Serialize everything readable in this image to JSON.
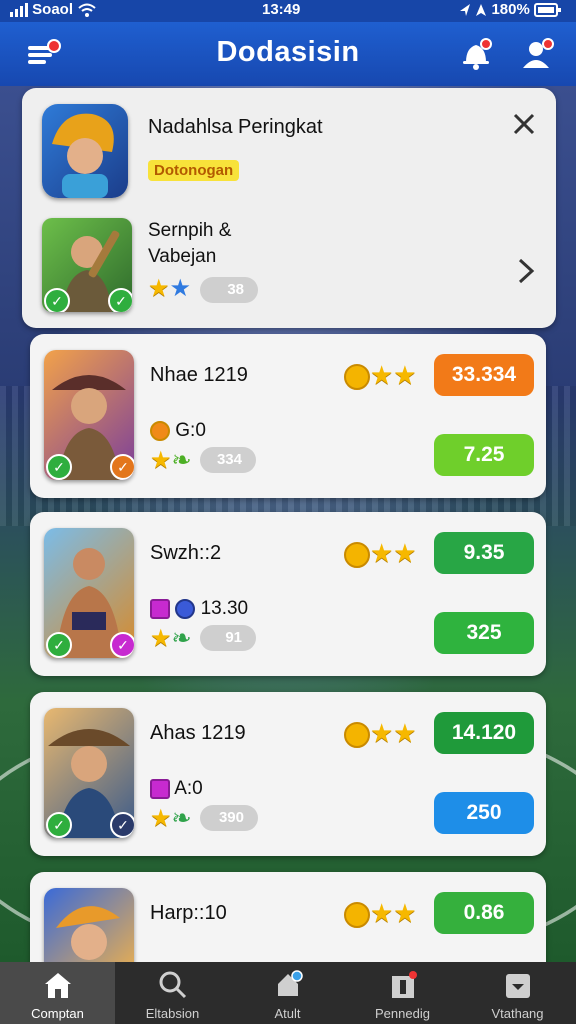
{
  "statusbar": {
    "carrier": "Soaol",
    "time": "13:49",
    "battery": "180%"
  },
  "header": {
    "title": "Dodasisin"
  },
  "panel": {
    "title": "Nadahlsa Peringkat",
    "tag": "Dotonogan",
    "subtitle_line1": "Sernpih &",
    "subtitle_line2": "Vabejan",
    "pill_value": "38"
  },
  "rows": [
    {
      "name": "Nhae 1219",
      "stat": "G:0",
      "pill": "334",
      "btn_top": "33.334",
      "btn_bot": "7.25",
      "top_color": "#f27a18",
      "bot_color": "#6fcf2b"
    },
    {
      "name": "Swzh::2",
      "stat": "13.30",
      "pill": "91",
      "btn_top": "9.35",
      "btn_bot": "325",
      "top_color": "#28a645",
      "bot_color": "#2fb33e"
    },
    {
      "name": "Ahas 1219",
      "stat": "A:0",
      "pill": "390",
      "btn_top": "14.120",
      "btn_bot": "250",
      "top_color": "#1f9a3a",
      "bot_color": "#1e8ee8"
    },
    {
      "name": "Harp::10",
      "btn_top": "0.86",
      "top_color": "#35b03d"
    }
  ],
  "nav": [
    {
      "label": "Comptan",
      "icon": "home-icon"
    },
    {
      "label": "Eltabsion",
      "icon": "search-icon"
    },
    {
      "label": "Atult",
      "icon": "bell-icon"
    },
    {
      "label": "Pennedig",
      "icon": "building-icon"
    },
    {
      "label": "Vtathang",
      "icon": "shop-icon"
    }
  ]
}
